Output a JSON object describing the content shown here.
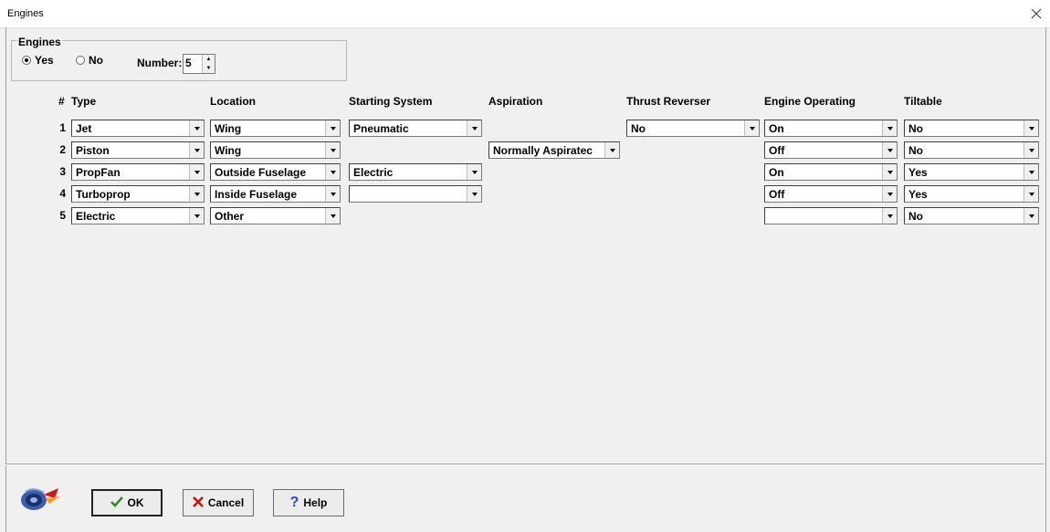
{
  "window": {
    "title": "Engines"
  },
  "engines_group": {
    "legend": "Engines",
    "yes_label": "Yes",
    "no_label": "No",
    "selected": "Yes",
    "number_label": "Number:",
    "number_value": "5"
  },
  "headers": {
    "num": "#",
    "type": "Type",
    "location": "Location",
    "starting": "Starting System",
    "aspiration": "Aspiration",
    "reverser": "Thrust Reverser",
    "operating": "Engine Operating",
    "tiltable": "Tiltable"
  },
  "rows": [
    {
      "n": "1",
      "type": "Jet",
      "location": "Wing",
      "starting": "Pneumatic",
      "aspiration": null,
      "reverser": "No",
      "operating": "On",
      "tiltable": "No"
    },
    {
      "n": "2",
      "type": "Piston",
      "location": "Wing",
      "starting": null,
      "aspiration": "Normally Aspiratec",
      "reverser": null,
      "operating": "Off",
      "tiltable": "No"
    },
    {
      "n": "3",
      "type": "PropFan",
      "location": "Outside Fuselage",
      "starting": "Electric",
      "aspiration": null,
      "reverser": null,
      "operating": "On",
      "tiltable": "Yes"
    },
    {
      "n": "4",
      "type": "Turboprop",
      "location": "Inside Fuselage",
      "starting": "",
      "aspiration": null,
      "reverser": null,
      "operating": "Off",
      "tiltable": "Yes"
    },
    {
      "n": "5",
      "type": "Electric",
      "location": "Other",
      "starting": null,
      "aspiration": null,
      "reverser": null,
      "operating": "",
      "tiltable": "No"
    }
  ],
  "buttons": {
    "ok": "OK",
    "cancel": "Cancel",
    "help": "Help"
  },
  "icons": {
    "ok": "checkmark-icon",
    "cancel": "x-icon",
    "help": "question-icon",
    "logo": "app-logo-icon",
    "close": "close-icon"
  },
  "colors": {
    "ok_check": "#2e8b1f",
    "cancel_x": "#c8140a",
    "help_q": "#1d4fd6"
  }
}
